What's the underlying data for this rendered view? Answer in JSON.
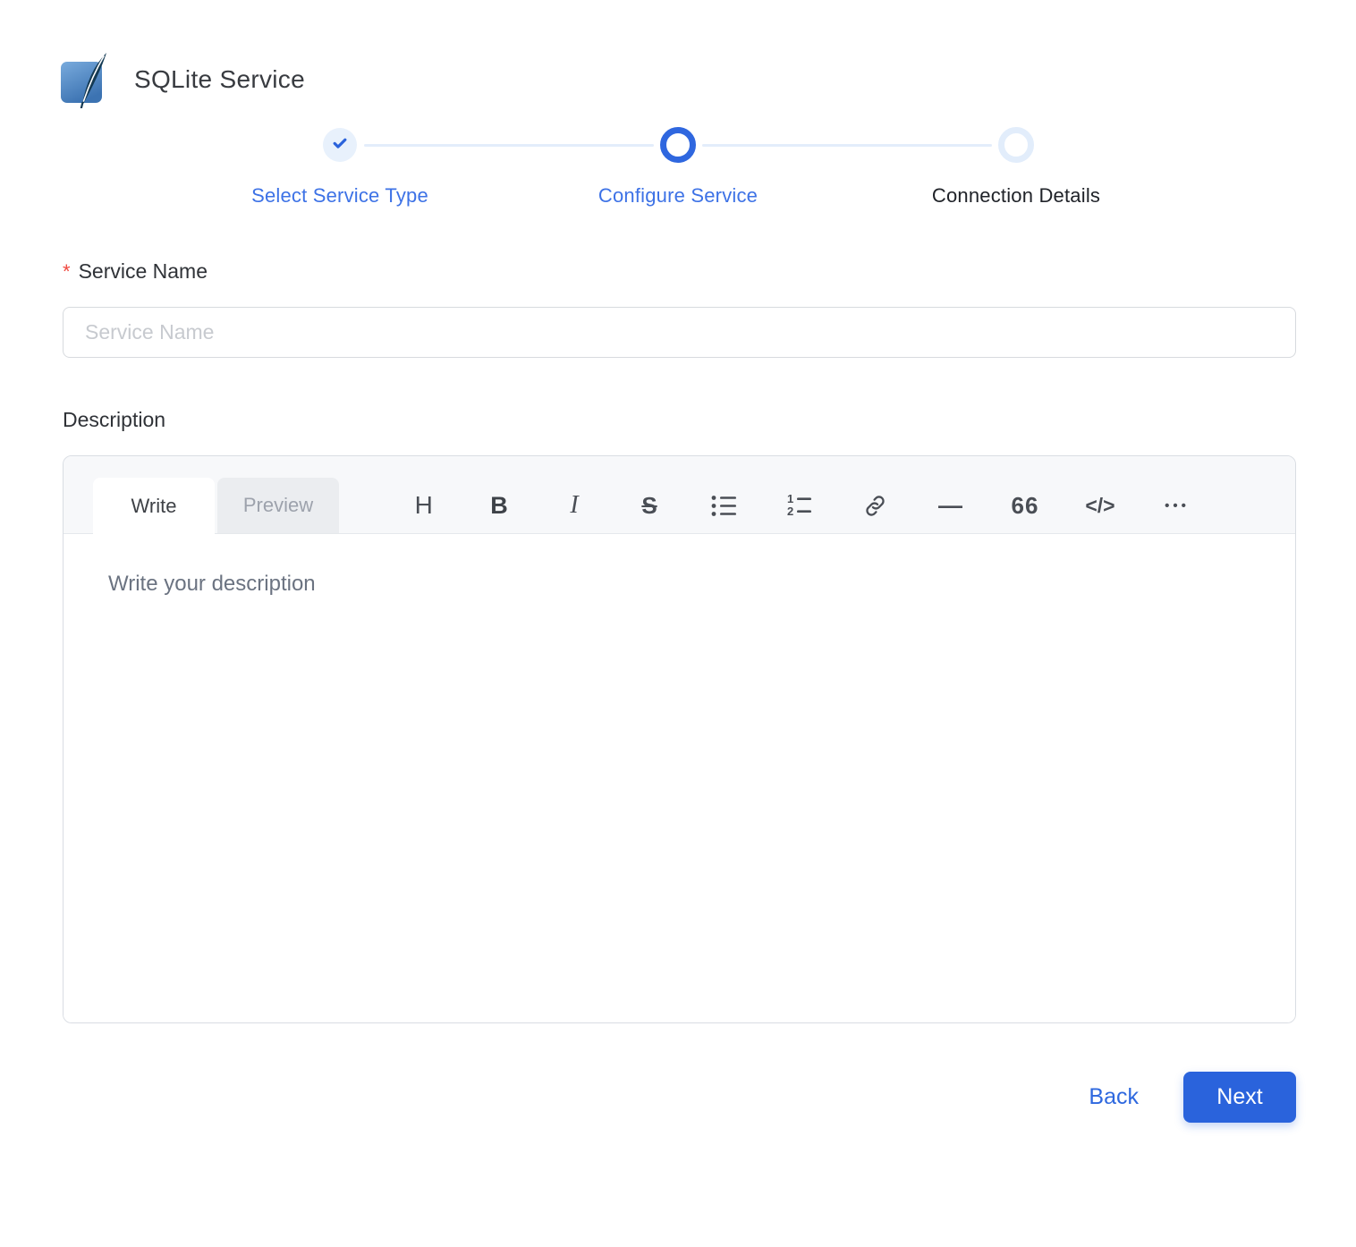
{
  "header": {
    "title": "SQLite Service",
    "logo_icon": "sqlite-logo-icon"
  },
  "stepper": {
    "steps": [
      {
        "label": "Select Service Type",
        "state": "completed",
        "icon": "check-icon"
      },
      {
        "label": "Configure Service",
        "state": "active"
      },
      {
        "label": "Connection Details",
        "state": "pending"
      }
    ]
  },
  "form": {
    "service_name": {
      "label": "Service Name",
      "required_marker": "*",
      "placeholder": "Service Name",
      "value": ""
    },
    "description": {
      "label": "Description",
      "value": "",
      "editor": {
        "tabs": [
          {
            "label": "Write",
            "active": true
          },
          {
            "label": "Preview",
            "active": false
          }
        ],
        "placeholder": "Write your description",
        "toolbar": [
          {
            "name": "heading-icon",
            "glyph": "H"
          },
          {
            "name": "bold-icon",
            "glyph": "B"
          },
          {
            "name": "italic-icon",
            "glyph": "I"
          },
          {
            "name": "strikethrough-icon",
            "glyph": "S"
          },
          {
            "name": "bullet-list-icon"
          },
          {
            "name": "numbered-list-icon"
          },
          {
            "name": "link-icon"
          },
          {
            "name": "horizontal-rule-icon",
            "glyph": "—"
          },
          {
            "name": "quote-icon",
            "glyph": "66"
          },
          {
            "name": "code-icon",
            "glyph": "</>"
          },
          {
            "name": "more-icon",
            "glyph": "•••"
          }
        ]
      }
    }
  },
  "footer": {
    "back_label": "Back",
    "next_label": "Next"
  },
  "colors": {
    "primary_blue": "#2a63dc",
    "stepper_label_blue": "#3d72e6",
    "stepper_line_light_blue": "#e3edfb",
    "completed_circle_bg": "#e8f1fc",
    "required_red": "#f0483f",
    "editor_header_gray": "#f7f8fa",
    "placeholder_gray": "#6b7381"
  }
}
